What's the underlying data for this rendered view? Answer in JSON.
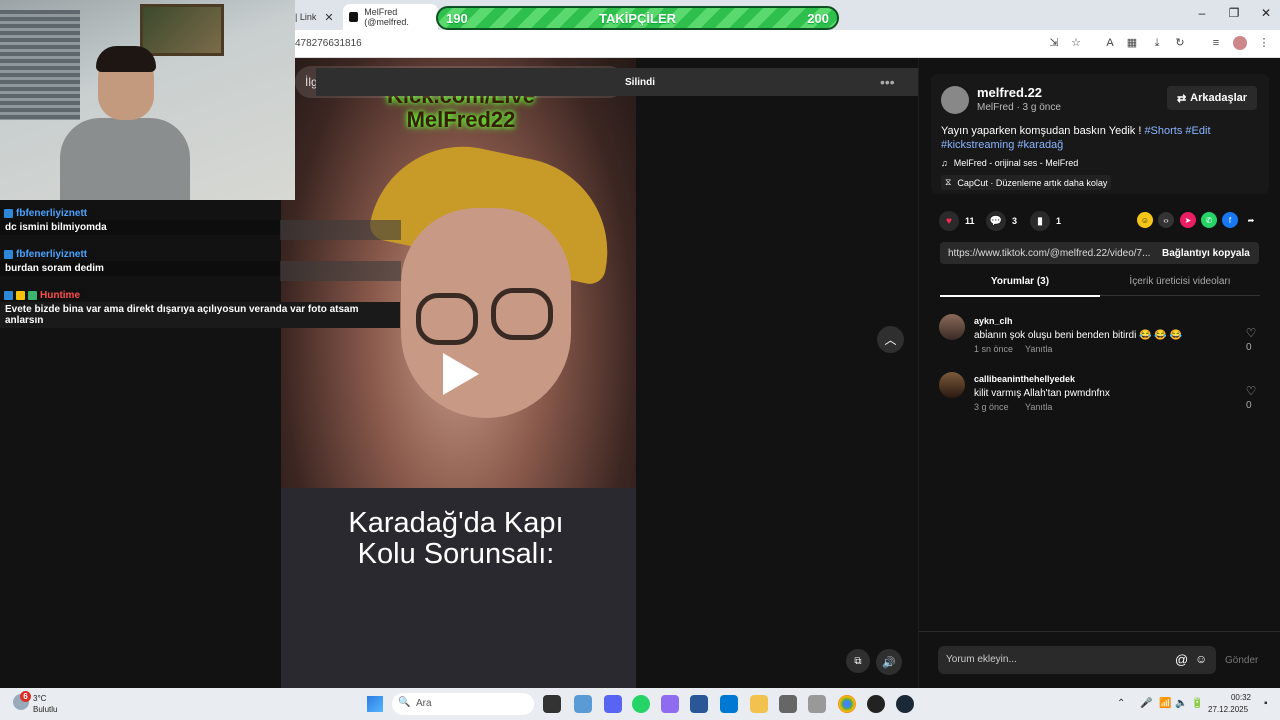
{
  "browser": {
    "tab1_label": "| Link",
    "tab2_label": "MelFred (@melfred.",
    "url_fragment": "478276631816"
  },
  "follower_goal": {
    "label": "TAKİPÇİLER",
    "current": "190",
    "target": "200",
    "progress_fraction": 0.95
  },
  "chat": [
    {
      "user": "fbfenerliyiznett",
      "message": "dc ismini bilmiyomda",
      "user_color": "#4aa3ff"
    },
    {
      "user": "fbfenerliyiznett",
      "message": "burdan soram dedim",
      "user_color": "#4aa3ff"
    },
    {
      "user": "Huntime",
      "message": "Evete bizde bina var ama direkt dışarıya açılıyosun veranda var foto atsam anlarsın",
      "user_color": "#ff4d4d"
    }
  ],
  "video": {
    "overlay_text": "Kick.com/Live MelFred22",
    "caption_overlay": "Karadağ'da Kapı Kolu Sorunsalı:"
  },
  "search": {
    "placeholder_fragment": "İlg"
  },
  "toast": {
    "text": "Silindi"
  },
  "post": {
    "author": "melfred.22",
    "meta": "MelFred · 3 g önce",
    "friends_button": "Arkadaşlar",
    "caption_text": "Yayın yaparken komşudan baskın Yedik ! ",
    "hashtags": [
      "#Shorts",
      "#Edit",
      "#kickstreaming",
      "#karadağ"
    ],
    "sound": "MelFred - orijinal ses - MelFred",
    "capcut": "CapCut · Düzenleme artık daha kolay",
    "likes": "11",
    "comments": "3",
    "saves": "1",
    "link": "https://www.tiktok.com/@melfred.22/video/7...",
    "copy_link": "Bağlantıyı kopyala",
    "tab_comments": "Yorumlar (3)",
    "tab_creator": "İçerik üreticisi videoları"
  },
  "comments": [
    {
      "user": "aykn_clh",
      "text": "abi̇anın şok oluşu beni benden bitirdi 😂 😂 😂",
      "time": "1 sn önce",
      "reply": "Yanıtla",
      "likes": "0"
    },
    {
      "user": "callibeaninthehellyedek",
      "text": "kilit varmış Allah'tan pwmdnfnx",
      "time": "3 g önce",
      "reply": "Yanıtla",
      "likes": "0"
    }
  ],
  "comment_input": {
    "placeholder": "Yorum ekleyin...",
    "send": "Gönder"
  },
  "taskbar": {
    "weather_badge": "6",
    "temperature": "3°C",
    "condition": "Bulutlu",
    "search_placeholder": "Ara",
    "time": "00:32",
    "date": "27.12.2025"
  }
}
